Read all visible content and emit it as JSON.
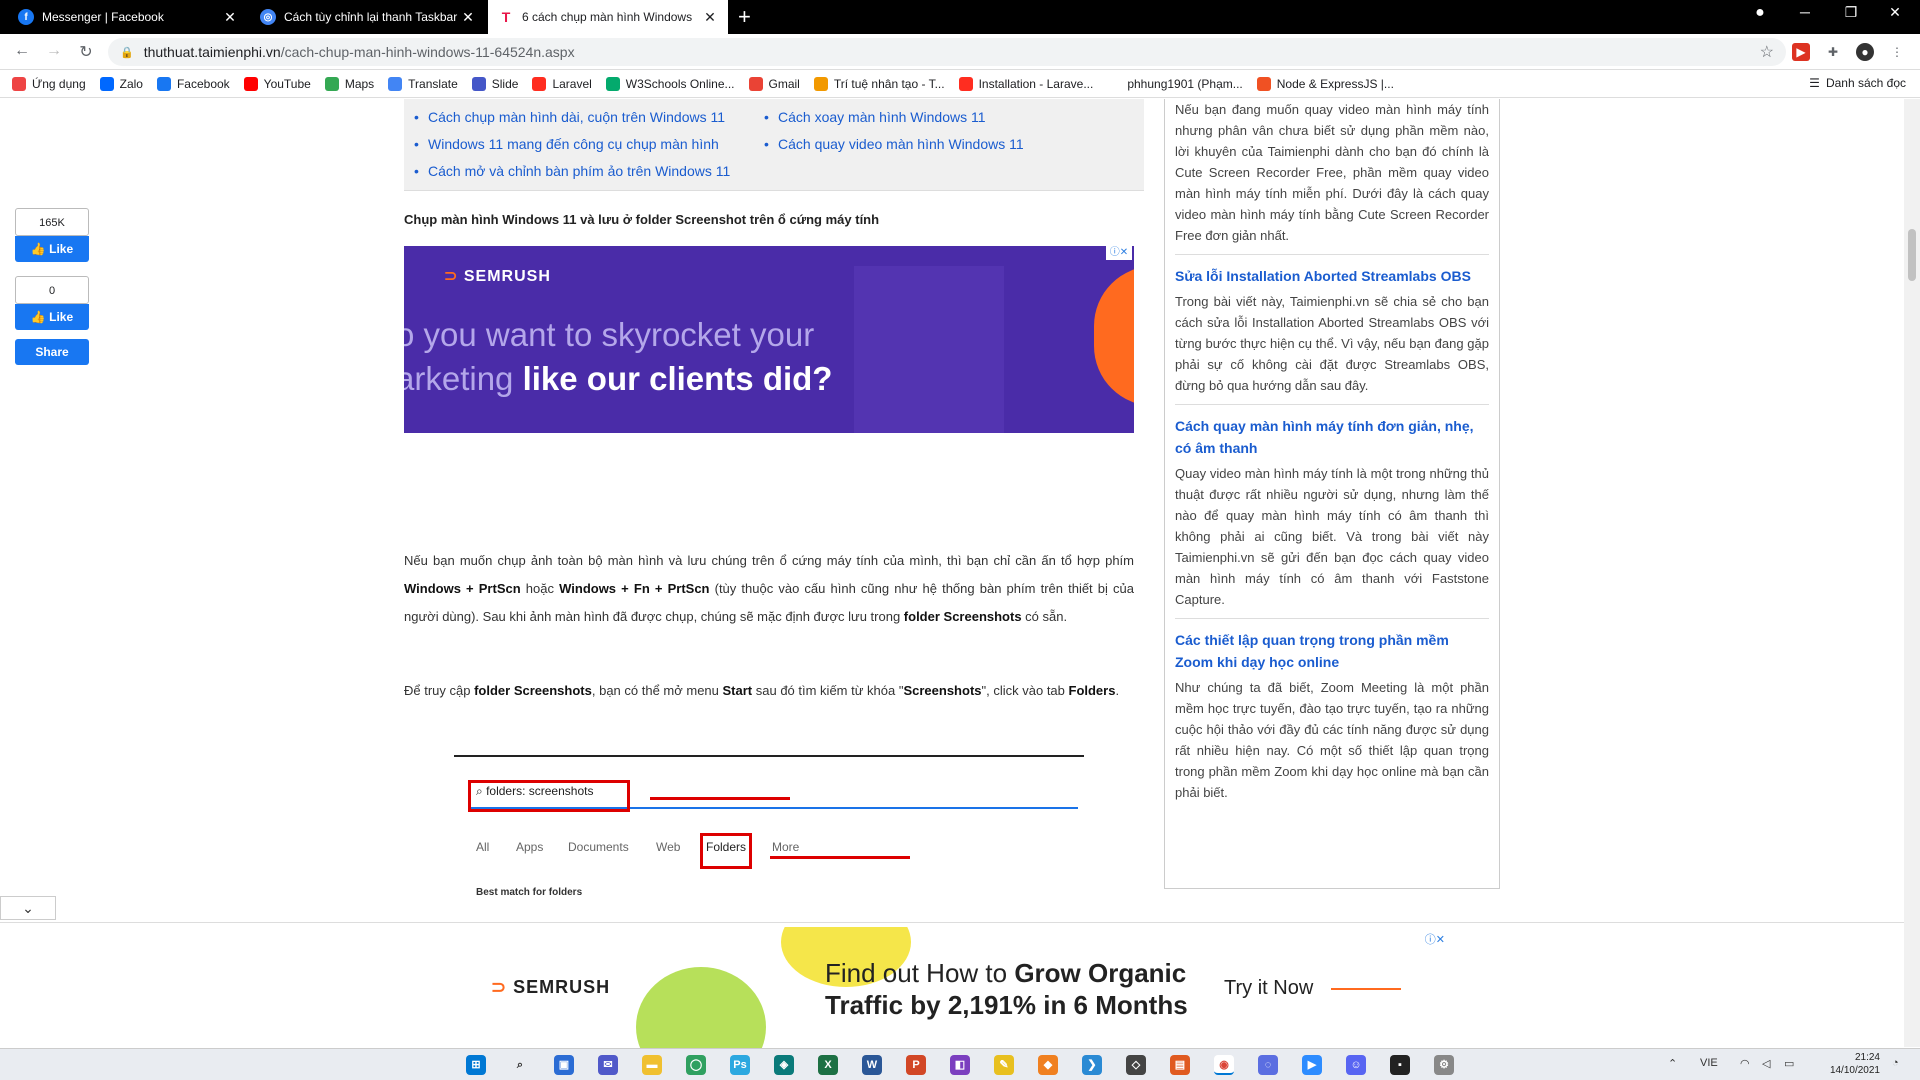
{
  "tabs": [
    {
      "title": "Messenger | Facebook",
      "favicon": "facebook-icon",
      "close": "✕"
    },
    {
      "title": "Cách tùy chỉnh lại thanh Taskbar",
      "favicon": "chrome-page-icon",
      "close": "✕"
    },
    {
      "title": "6 cách chụp màn hình Windows",
      "favicon": "taimienphi-icon",
      "close": "✕"
    }
  ],
  "omnibox": {
    "host": "thuthuat.taimienphi.vn",
    "path": "/cach-chup-man-hinh-windows-11-64524n.aspx"
  },
  "bookmarks": [
    {
      "label": "Ứng dụng",
      "icon": "apps-icon",
      "color": "#e44"
    },
    {
      "label": "Zalo",
      "icon": "zalo-icon",
      "color": "#0068ff"
    },
    {
      "label": "Facebook",
      "icon": "facebook-icon",
      "color": "#1877f2"
    },
    {
      "label": "YouTube",
      "icon": "youtube-icon",
      "color": "#f00"
    },
    {
      "label": "Maps",
      "icon": "maps-icon",
      "color": "#34a853"
    },
    {
      "label": "Translate",
      "icon": "translate-icon",
      "color": "#4285f4"
    },
    {
      "label": "Slide",
      "icon": "slide-icon",
      "color": "#4557c8"
    },
    {
      "label": "Laravel",
      "icon": "laravel-icon",
      "color": "#ff2d20"
    },
    {
      "label": "W3Schools Online...",
      "icon": "w3schools-icon",
      "color": "#04aa6d"
    },
    {
      "label": "Gmail",
      "icon": "gmail-icon",
      "color": "#ea4335"
    },
    {
      "label": "Trí tuệ nhân tạo - T...",
      "icon": "ai-icon",
      "color": "#f29900"
    },
    {
      "label": "Installation - Larave...",
      "icon": "laravel-icon",
      "color": "#ff2d20"
    },
    {
      "label": "phhung1901 (Phạm...",
      "icon": "github-icon",
      "color": "#fff"
    },
    {
      "label": "Node & ExpressJS |...",
      "icon": "f8-icon",
      "color": "#f05123"
    }
  ],
  "reading_list": "Danh sách đọc",
  "related_links": {
    "left": [
      "Cách chụp màn hình dài, cuộn trên Windows 11",
      "Windows 11 mang đến công cụ chụp màn hình",
      "Cách mở và chỉnh bàn phím ảo trên Windows 11"
    ],
    "right": [
      "Cách xoay màn hình Windows 11",
      "Cách quay video màn hình Windows 11"
    ]
  },
  "social": {
    "count1": "165K",
    "like1": "Like",
    "count2": "0",
    "like2": "Like",
    "share": "Share"
  },
  "article": {
    "heading": "Chụp màn hình Windows 11 và lưu ở folder Screenshot trên ổ cứng máy tính",
    "p1": [
      {
        "t": "Nếu bạn muốn chụp ảnh toàn bộ màn hình và lưu chúng trên ổ cứng máy tính của mình, thì bạn chỉ cần ấn tổ hợp phím ",
        "b": false
      },
      {
        "t": "Windows + PrtScn",
        "b": true
      },
      {
        "t": " hoặc ",
        "b": false
      },
      {
        "t": "Windows + Fn + PrtScn",
        "b": true
      },
      {
        "t": " (tùy thuộc vào cấu hình cũng như hệ thống bàn phím trên thiết bị của người dùng). Sau khi ảnh màn hình đã được chụp, chúng sẽ mặc định được lưu trong ",
        "b": false
      },
      {
        "t": "folder Screenshots",
        "b": true
      },
      {
        "t": " có sẵn.",
        "b": false
      }
    ],
    "p2": [
      {
        "t": "Để truy cập ",
        "b": false
      },
      {
        "t": "folder Screenshots",
        "b": true
      },
      {
        "t": ", bạn có thể mở menu ",
        "b": false
      },
      {
        "t": "Start",
        "b": true
      },
      {
        "t": " sau đó tìm kiếm từ khóa \"",
        "b": false
      },
      {
        "t": "Screenshots",
        "b": true
      },
      {
        "t": "\", click vào tab ",
        "b": false
      },
      {
        "t": "Folders",
        "b": true
      },
      {
        "t": ".",
        "b": false
      }
    ]
  },
  "ad1": {
    "brand": "SEMRUSH",
    "line1": "o you want to skyrocket your",
    "line2a": "arketing ",
    "line2b": "like our clients did?",
    "adchoice": "ⓘ✕"
  },
  "screenshot": {
    "query": "folders: screenshots",
    "tabs": [
      "All",
      "Apps",
      "Documents",
      "Web",
      "Folders",
      "More"
    ],
    "best": "Best match for folders"
  },
  "sidebar": [
    {
      "title": "",
      "text": "Nếu bạn đang muốn quay video màn hình máy tính nhưng phân vân chưa biết sử dụng phần mềm nào, lời khuyên của Taimienphi dành cho bạn đó chính là Cute Screen Recorder Free, phần mềm quay video màn hình máy tính miễn phí. Dưới đây là cách quay video màn hình máy tính bằng Cute Screen Recorder Free đơn giản nhất."
    },
    {
      "title": "Sửa lỗi Installation Aborted Streamlabs OBS",
      "text": "Trong bài viết này, Taimienphi.vn sẽ chia sẻ cho bạn cách sửa lỗi Installation Aborted Streamlabs OBS với từng bước thực hiện cụ thể. Vì vậy, nếu bạn đang gặp phải sự cố không cài đặt được Streamlabs OBS, đừng bỏ qua hướng dẫn sau đây."
    },
    {
      "title": "Cách quay màn hình máy tính đơn giản, nhẹ, có âm thanh",
      "text": "Quay video màn hình máy tính là một trong những thủ thuật được rất nhiều người sử dụng, nhưng làm thế nào để quay màn hình máy tính có âm thanh thì không phải ai cũng biết. Và trong bài viết này Taimienphi.vn sẽ gửi đến bạn đọc cách quay video màn hình máy tính có âm thanh với Faststone Capture."
    },
    {
      "title": "Các thiết lập quan trọng trong phần mềm Zoom khi dạy học online",
      "text": "Như chúng ta đã biết, Zoom Meeting là một phần mềm học trực tuyến, đào tạo trực tuyến, tạo ra những cuộc hội thảo với đầy đủ các tính năng được sử dụng rất nhiều hiện nay. Có một số thiết lập quan trọng trong phần mềm Zoom khi dạy học online mà bạn cần phải biết."
    }
  ],
  "ad2": {
    "brand": "SEMRUSH",
    "head1a": "Find out How to ",
    "head1b": "Grow Organic",
    "head2": "Traffic by 2,191% in 6 Months",
    "cta": "Try it Now",
    "adchoice": "ⓘ✕"
  },
  "taskbar": {
    "lang": "VIE",
    "time": "21:24",
    "date": "14/10/2021"
  }
}
